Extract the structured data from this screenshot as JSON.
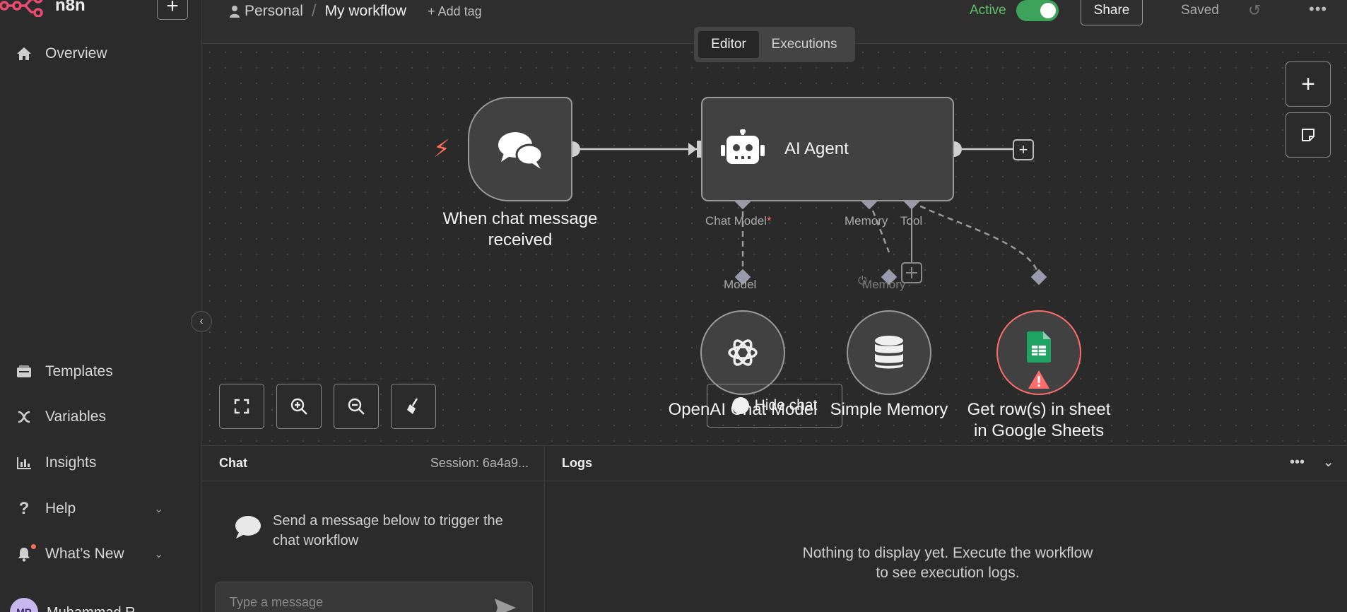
{
  "app": {
    "logo_text": "n8n"
  },
  "sidebar": {
    "items_top": [
      {
        "label": "Overview",
        "icon": "home-icon"
      }
    ],
    "items_bottom": [
      {
        "label": "Templates",
        "icon": "templates-icon"
      },
      {
        "label": "Variables",
        "icon": "variables-icon"
      },
      {
        "label": "Insights",
        "icon": "insights-icon"
      },
      {
        "label": "Help",
        "icon": "help-icon"
      },
      {
        "label": "What’s New",
        "icon": "bell-icon"
      }
    ],
    "user": {
      "initials": "MR",
      "name": "Muhammad R..."
    }
  },
  "header": {
    "project": "Personal",
    "workflow": "My workflow",
    "add_tag": "+ Add tag",
    "active_label": "Active",
    "share_label": "Share",
    "saved_label": "Saved"
  },
  "tabs": [
    {
      "label": "Editor",
      "selected": true
    },
    {
      "label": "Executions",
      "selected": false
    }
  ],
  "canvas": {
    "nodes": {
      "trigger": {
        "label_line1": "When chat message",
        "label_line2": "received"
      },
      "agent": {
        "title": "AI Agent"
      },
      "openai": {
        "label": "OpenAI Chat Model"
      },
      "memory": {
        "label": "Simple Memory"
      },
      "sheets": {
        "label_line1": "Get row(s) in sheet",
        "label_line2": "in Google Sheets"
      }
    },
    "ports": {
      "chat_model": "Chat Model",
      "required_mark": "*",
      "memory": "Memory",
      "tool": "Tool",
      "model": "Model",
      "memory_ghost": "Memory"
    },
    "hide_chat": "Hide chat"
  },
  "chat": {
    "title": "Chat",
    "session": "Session: 6a4a9...",
    "hint": "Send a message below to trigger the chat workflow",
    "placeholder": "Type a message"
  },
  "logs": {
    "title": "Logs",
    "empty": "Nothing to display yet. Execute the workflow to see execution logs."
  },
  "colors": {
    "accent": "#ff6d5a",
    "active": "#3ea35a",
    "error": "#ff6d6d"
  }
}
